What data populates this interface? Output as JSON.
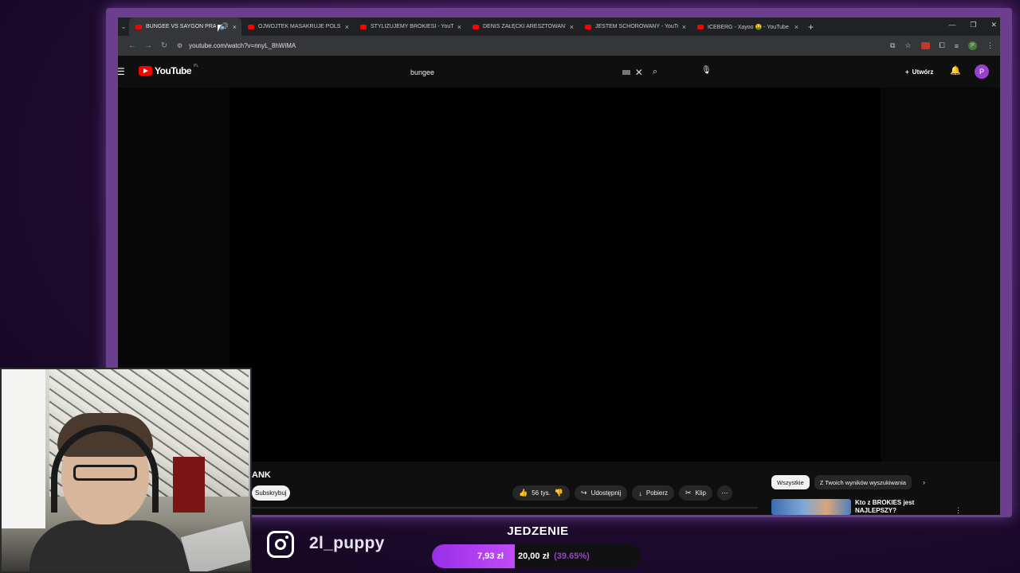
{
  "browser": {
    "tabs": [
      {
        "title": "BUNGEE VS SAYGON PRANK",
        "active": true
      },
      {
        "title": "OJWOJTEK MASAKRUJE POLSKI"
      },
      {
        "title": "STYLIZUJEMY BROKIESI - YouTube"
      },
      {
        "title": "DENIS ZAŁĘCKI ARESZTOWANY"
      },
      {
        "title": "JESTEM SCHOROWANY - YouTube"
      },
      {
        "title": "ICEBERG - Xayoo 🤑 - YouTube"
      }
    ],
    "url": "youtube.com/watch?v=nnyL_8hWiMA"
  },
  "youtube": {
    "logo_text": "YouTube",
    "region": "PL",
    "search_query": "bungee",
    "create_label": "Utwórz",
    "avatar_letter": "P",
    "video_title": "ANK",
    "subscribe_label": "Subskrybuj",
    "likes": "56 tys.",
    "share_label": "Udostępnij",
    "download_label": "Pobierz",
    "clip_label": "Klip",
    "chips": [
      "Wszystkie",
      "Z Twoich wyników wyszukiwania"
    ],
    "recommendation": {
      "title": "Kto z BROKIES jest NAJLEPSZY?"
    }
  },
  "overlay": {
    "instagram_handle": "2l_puppy",
    "goal_title": "JEDZENIE",
    "goal_current": "7,93 zł",
    "goal_target": "20,00 zł",
    "goal_percent_text": "(39.65%)",
    "goal_fraction": 0.3965
  },
  "colors": {
    "accent": "#9b3fcf",
    "youtube_red": "#ff0000",
    "frame": "#6c3f8e"
  }
}
